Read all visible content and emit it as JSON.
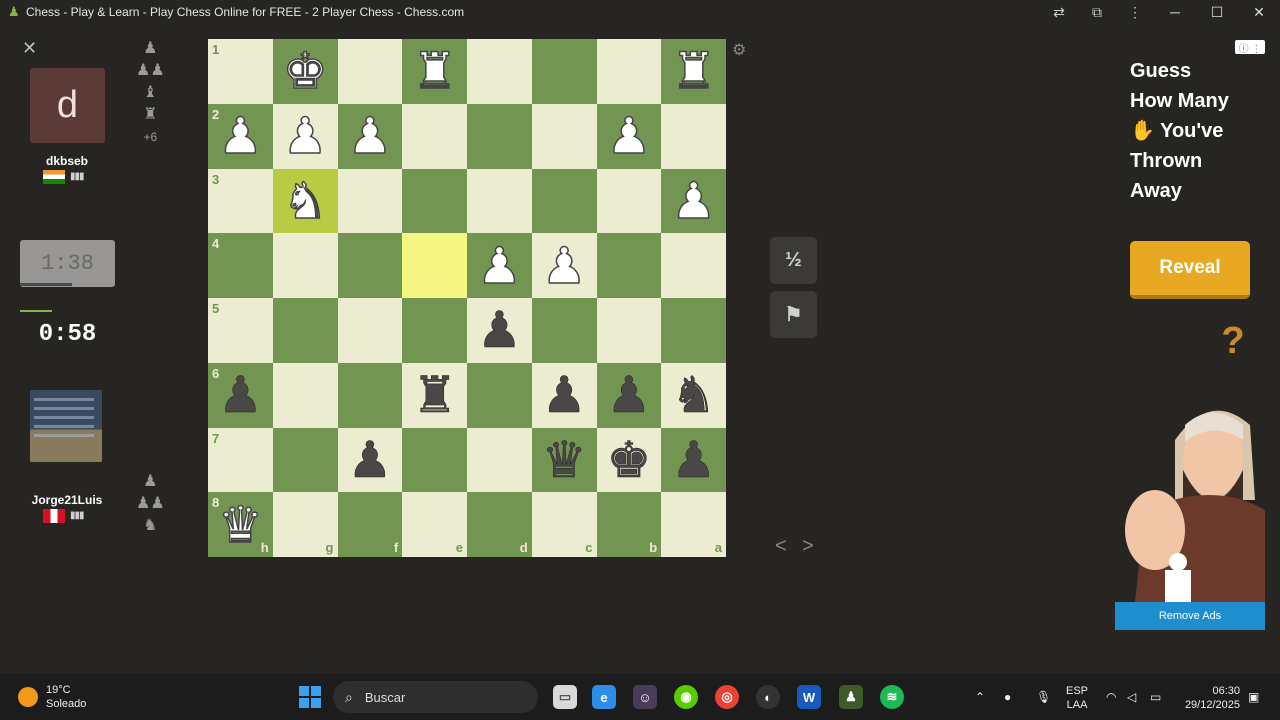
{
  "window": {
    "title": "Chess - Play & Learn - Play Chess Online for FREE - 2 Player Chess - Chess.com",
    "minimize": "─",
    "maximize": "☐",
    "close": "✕"
  },
  "left_panel": {
    "close": "✕",
    "top_player": {
      "avatar_letter": "d",
      "name": "dkbseb",
      "flag": "india",
      "signal": "▮▮▮",
      "captured": [
        "♟",
        "♟♟",
        "♝",
        "♜"
      ],
      "captured_extra": "+6",
      "clock": "1:38"
    },
    "bottom_player": {
      "name": "Jorge21Luis",
      "flag": "peru",
      "signal": "▮▮▮",
      "captured": [
        "♟",
        "♟♟",
        "♞"
      ],
      "clock": "0:58"
    }
  },
  "board": {
    "ranks": [
      "1",
      "2",
      "3",
      "4",
      "5",
      "6",
      "7",
      "8"
    ],
    "files": [
      "h",
      "g",
      "f",
      "e",
      "d",
      "c",
      "b",
      "a"
    ],
    "squares": [
      [
        "",
        "wK",
        "",
        "wR",
        "",
        "",
        "",
        "wR"
      ],
      [
        "wP",
        "wP",
        "wP",
        "",
        "",
        "",
        "wP",
        ""
      ],
      [
        "",
        "wN",
        "",
        "",
        "",
        "",
        "",
        "wP"
      ],
      [
        "",
        "",
        "",
        "",
        "wP",
        "wP",
        "",
        ""
      ],
      [
        "",
        "",
        "",
        "",
        "bP",
        "",
        "",
        ""
      ],
      [
        "bP",
        "",
        "",
        "bR",
        "",
        "bP",
        "bP",
        "bN"
      ],
      [
        "",
        "",
        "bP",
        "",
        "",
        "bQ",
        "bK",
        "bP"
      ],
      [
        "wQ",
        "",
        "",
        "",
        "",
        "",
        "",
        ""
      ]
    ],
    "highlight_yellow": [
      [
        3,
        3
      ]
    ],
    "highlight_yg": [
      [
        2,
        1
      ]
    ]
  },
  "controls": {
    "draw_label": "½",
    "resign_icon": "⚑",
    "settings_icon": "⚙",
    "prev": "<",
    "next": ">"
  },
  "ad": {
    "info": "ⓘ ⋮",
    "headline_lines": [
      "Guess",
      "How Many",
      "✋ You've",
      "Thrown",
      "Away"
    ],
    "reveal": "Reveal",
    "question": "?",
    "remove_ads": "Remove Ads"
  },
  "taskbar": {
    "weather_temp": "19°C",
    "weather_desc": "Soleado",
    "search_placeholder": "Buscar",
    "lang_top": "ESP",
    "lang_bottom": "LAA",
    "time": "06:30",
    "date": "29/12/2025"
  },
  "pieces": {
    "wK": "♚",
    "wQ": "♛",
    "wR": "♜",
    "wB": "♝",
    "wN": "♞",
    "wP": "♟",
    "bK": "♚",
    "bQ": "♛",
    "bR": "♜",
    "bB": "♝",
    "bN": "♞",
    "bP": "♟"
  }
}
